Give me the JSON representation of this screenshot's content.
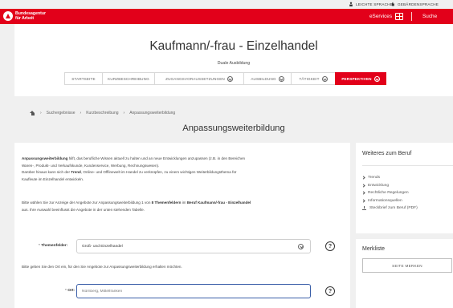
{
  "util_bar": {
    "leichte_sprache": "LEICHTE SPRACHE",
    "gebaerdensprache": "GEBÄRDENSPRACHE"
  },
  "header": {
    "logo_line1": "Bundesagentur",
    "logo_line2": "für Arbeit",
    "eservices": "eServices",
    "suche": "Suche",
    "brand_color": "#e2001a"
  },
  "title": {
    "main": "Kaufmann/-frau - Einzelhandel",
    "subtitle": "Duale Ausbildung"
  },
  "nav": {
    "tabs": [
      {
        "label": "STARTSEITE",
        "dropdown": false,
        "active": false
      },
      {
        "label": "KURZBESCHREIBUNG",
        "dropdown": false,
        "active": false
      },
      {
        "label": "ZUGANGSVORAUSSETZUNGEN",
        "dropdown": true,
        "active": false
      },
      {
        "label": "AUSBILDUNG",
        "dropdown": true,
        "active": false
      },
      {
        "label": "TÄTIGKEIT",
        "dropdown": true,
        "active": false
      },
      {
        "label": "PERSPEKTIVEN",
        "dropdown": true,
        "active": true
      }
    ]
  },
  "breadcrumb": {
    "items": [
      "Suchergebnisse",
      "Kurzbeschreibung",
      "Anpassungsweiterbildung"
    ]
  },
  "section": {
    "title": "Anpassungsweiterbildung"
  },
  "content": {
    "p1_bold": "Anpassungsweiterbildung",
    "p1_line1": " hilft, das berufliche Wissen aktuell zu halten und an neue Entwicklungen anzupassen (z.B. in den Bereichen",
    "p1_line2": "Waren-, Produkt- und Verkaufskunde, Kundenservice, Werbung, Rechnungswesen).",
    "p2_a": "Darüber hinaus kann sich der ",
    "p2_bold": "Trend",
    "p2_b": ", Online- und Offlinewelt im Handel zu verknüpfen, zu einem wichtigen Weiterbildungsthema für",
    "p2_line2": "Kaufleute im Einzelhandel entwickeln.",
    "p3_a": "Bitte wählen Sie zur Anzeige der Angebote zur Anpassungsweiterbildung 1 von ",
    "p3_bold1": "8 Themenfeldern",
    "p3_b": " im ",
    "p3_bold2": "Beruf Kaufmann/-frau - Einzelhandel",
    "p3_line2": "aus. Ihre Auswahl beeinflusst die Angebote in der unten stehenden Tabelle.",
    "p4": "Bitte geben Sie den Ort ein, für den Sie Angebote zur Anpassungsweiterbildung erhalten möchten."
  },
  "form": {
    "themen_label": "Themenfelder:",
    "themen_value": "Groß- und Einzelhandel",
    "ort_label": "Ort:",
    "ort_placeholder": "Nürnberg, Mittelfranken",
    "required_marker": "*",
    "help_glyph": "?"
  },
  "sidebar": {
    "weiteres_title": "Weiteres zum Beruf",
    "links": [
      {
        "label": "Trends",
        "icon": "arrow-right-icon"
      },
      {
        "label": "Entwicklung",
        "icon": "arrow-right-icon"
      },
      {
        "label": "Rechtliche Regelungen",
        "icon": "arrow-right-icon"
      },
      {
        "label": "Informationsquellen",
        "icon": "arrow-right-icon"
      },
      {
        "label": "Steckbrief zum Beruf (PDF)",
        "icon": "download-icon"
      }
    ],
    "merkliste_title": "Merkliste",
    "merken_button": "SEITE MERKEN"
  }
}
